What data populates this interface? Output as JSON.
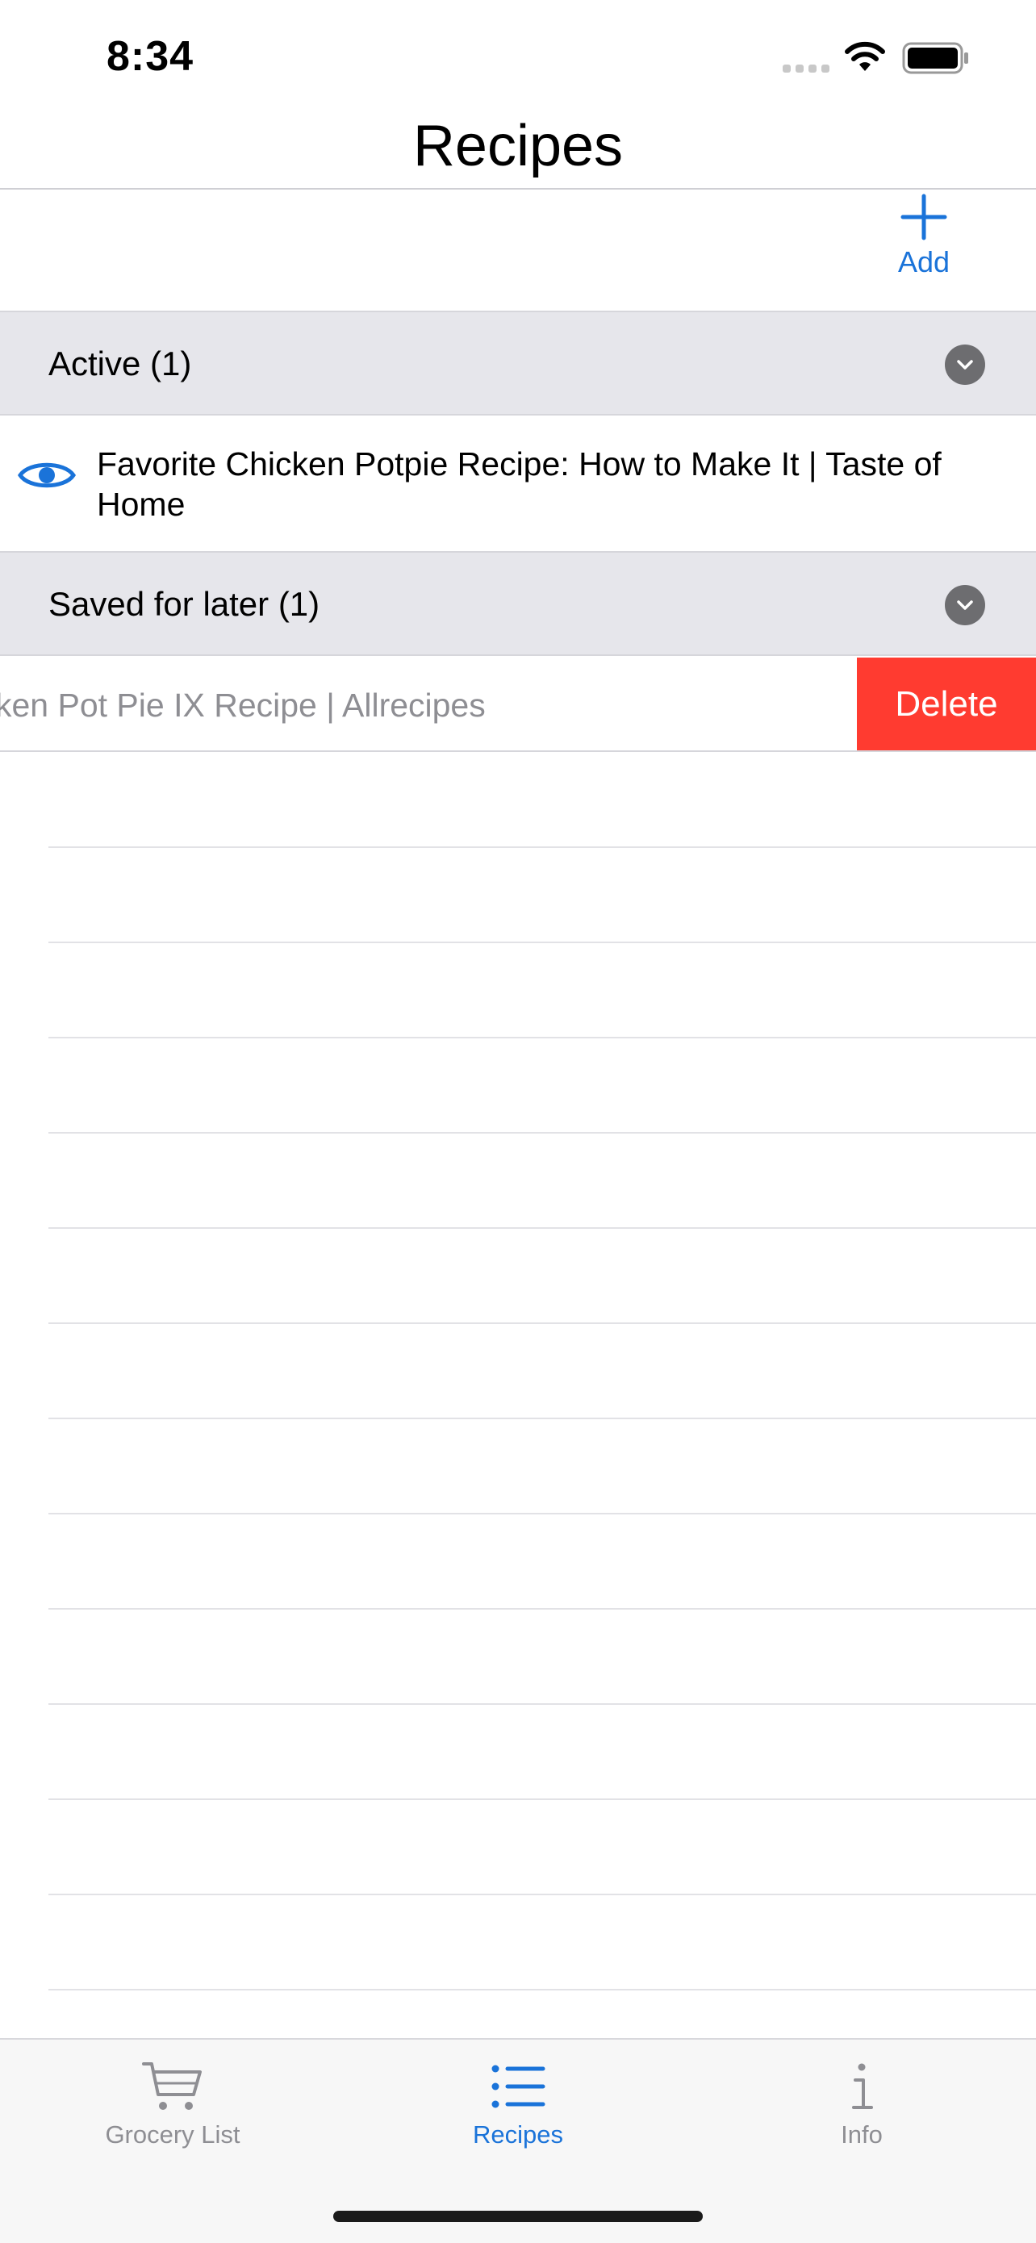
{
  "status_bar": {
    "time": "8:34"
  },
  "nav": {
    "title": "Recipes"
  },
  "toolbar": {
    "add_label": "Add"
  },
  "sections": {
    "active": {
      "title": "Active (1)"
    },
    "saved": {
      "title": "Saved for later (1)"
    }
  },
  "active_items": [
    {
      "title": "Favorite Chicken Potpie Recipe: How to Make It | Taste of Home"
    }
  ],
  "saved_items": [
    {
      "title_visible": "ken Pot Pie IX Recipe | Allrecipes",
      "delete_label": "Delete"
    }
  ],
  "tab_bar": {
    "tabs": [
      {
        "label": "Grocery List",
        "icon": "cart-icon",
        "selected": false
      },
      {
        "label": "Recipes",
        "icon": "list-icon",
        "selected": true
      },
      {
        "label": "Info",
        "icon": "info-icon",
        "selected": false
      }
    ]
  },
  "colors": {
    "accent": "#1a73d9",
    "destructive": "#ff3b30",
    "section_bg": "#e6e6eb"
  }
}
